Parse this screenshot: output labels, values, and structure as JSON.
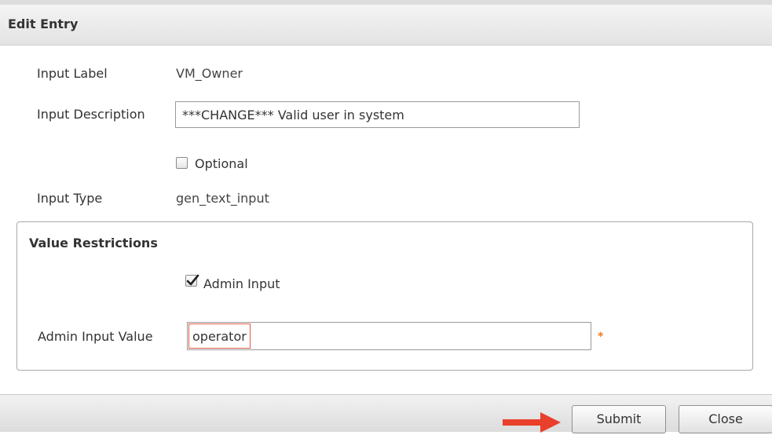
{
  "dialog": {
    "title": "Edit Entry"
  },
  "form": {
    "input_label": {
      "label": "Input Label",
      "value": "VM_Owner"
    },
    "input_description": {
      "label": "Input Description",
      "value": "***CHANGE*** Valid user in system"
    },
    "optional": {
      "label": "Optional",
      "checked": false
    },
    "input_type": {
      "label": "Input Type",
      "value": "gen_text_input"
    }
  },
  "value_restrictions": {
    "legend": "Value Restrictions",
    "admin_input": {
      "label": "Admin Input",
      "checked": true
    },
    "admin_input_value": {
      "label": "Admin Input Value",
      "value": "operator"
    },
    "required_marker": "*"
  },
  "footer": {
    "submit_label": "Submit",
    "close_label": "Close"
  },
  "colors": {
    "required": "#f07a1e",
    "arrow": "#e8402b",
    "focus_border": "#e05a4a"
  },
  "icons": {
    "pointer": "arrow-right-icon",
    "check": "checkmark-icon"
  }
}
